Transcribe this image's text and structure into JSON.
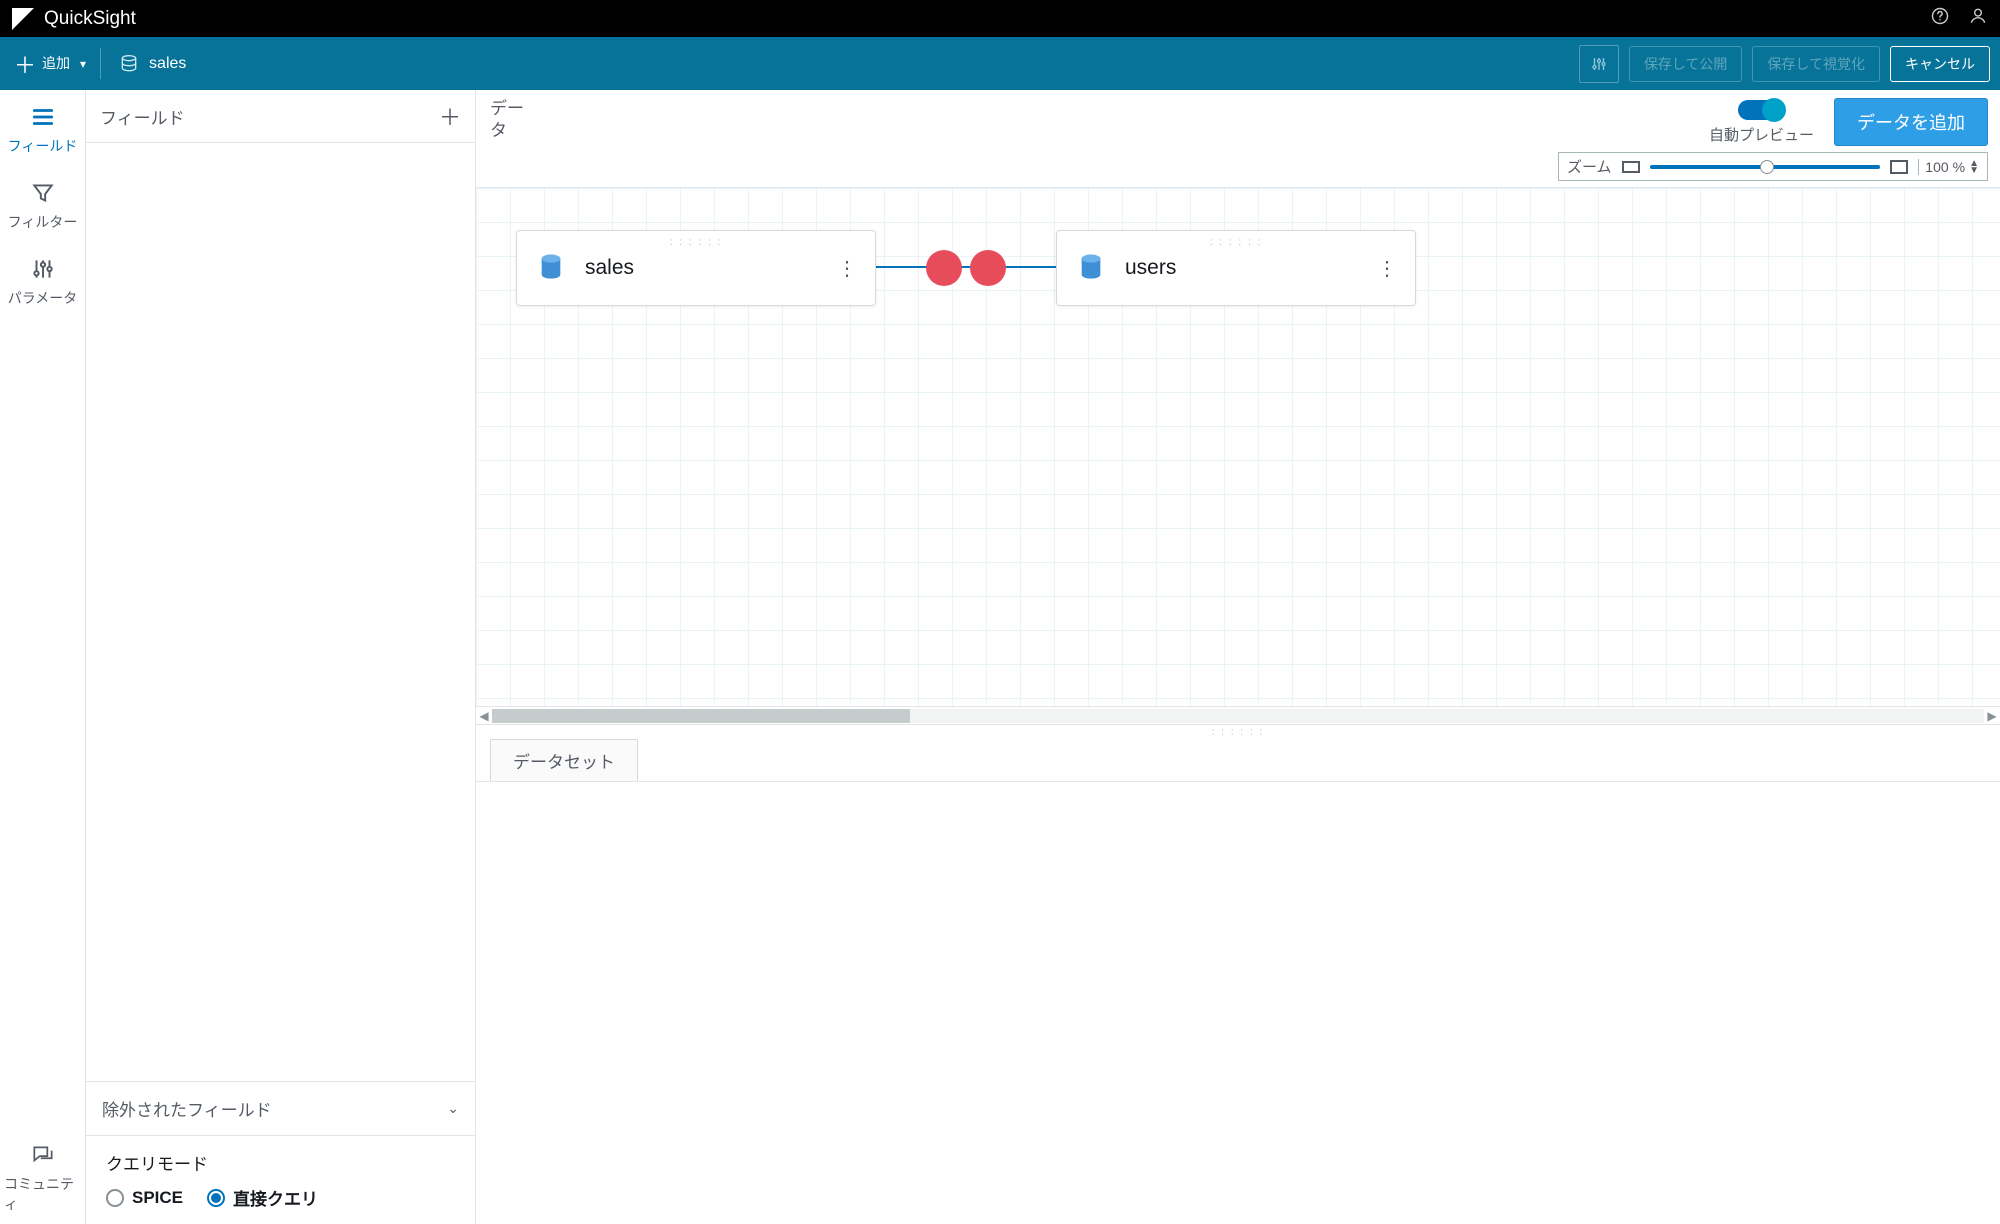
{
  "brand": "QuickSight",
  "topIcons": {
    "help": "?",
    "user": "👤"
  },
  "toolbar": {
    "add_label": "追加",
    "dataset_name": "sales",
    "save_publish": "保存して公開",
    "save_visualize": "保存して視覚化",
    "cancel": "キャンセル"
  },
  "sidebar": {
    "fields": "フィールド",
    "filters": "フィルター",
    "parameters": "パラメータ",
    "community": "コミュニティ"
  },
  "fieldsPanel": {
    "header": "フィールド",
    "excluded": "除外されたフィールド",
    "query_mode_title": "クエリモード",
    "spice": "SPICE",
    "direct": "直接クエリ",
    "selected": "direct"
  },
  "workspace": {
    "title": "データ",
    "auto_preview": "自動プレビュー",
    "add_data": "データを追加",
    "zoom_label": "ズーム",
    "zoom_pct": "100",
    "pct_sign": "%"
  },
  "nodes": [
    {
      "label": "sales"
    },
    {
      "label": "users"
    }
  ],
  "tabs": {
    "dataset": "データセット"
  }
}
